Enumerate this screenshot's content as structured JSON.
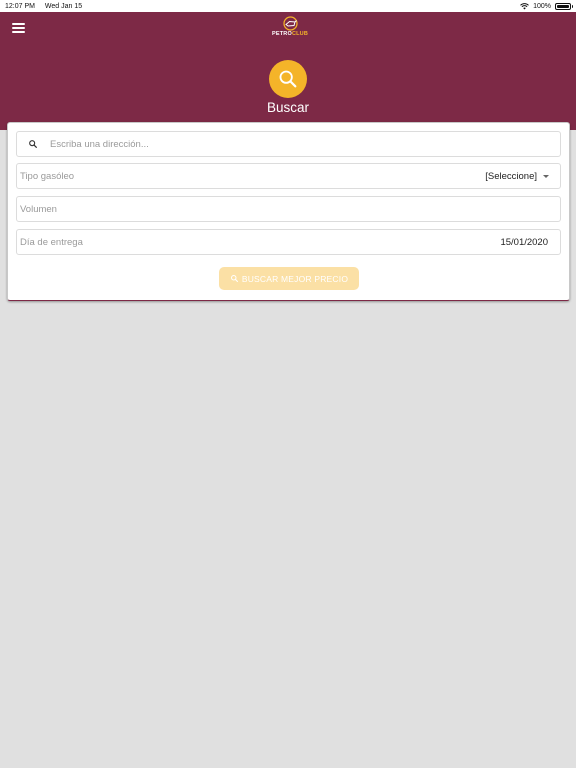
{
  "status_bar": {
    "time": "12:07 PM",
    "date": "Wed Jan 15",
    "battery": "100%"
  },
  "header": {
    "logo_part1": "PETRO",
    "logo_part2": "CLUB",
    "title": "Buscar",
    "brand_color": "#7d2946",
    "accent_color": "#f4b429"
  },
  "form": {
    "address_placeholder": "Escriba una dirección...",
    "fuel_label": "Tipo gasóleo",
    "fuel_value": "[Seleccione]",
    "volume_label": "Volumen",
    "date_label": "Día de entrega",
    "date_value": "15/01/2020",
    "submit_label": "BUSCAR MEJOR PRECIO"
  }
}
